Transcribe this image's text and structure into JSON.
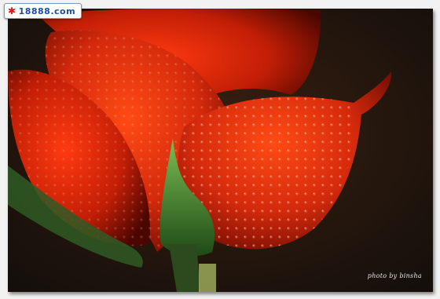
{
  "logo": {
    "icon": "asterisk-star-icon",
    "text": "18888.com"
  },
  "photo": {
    "credit": "photo by binsha"
  },
  "colors": {
    "petal": "#d42a0c",
    "petal_dark": "#5a0800",
    "leaf": "#3f7a2c",
    "background": "#1a1612"
  }
}
